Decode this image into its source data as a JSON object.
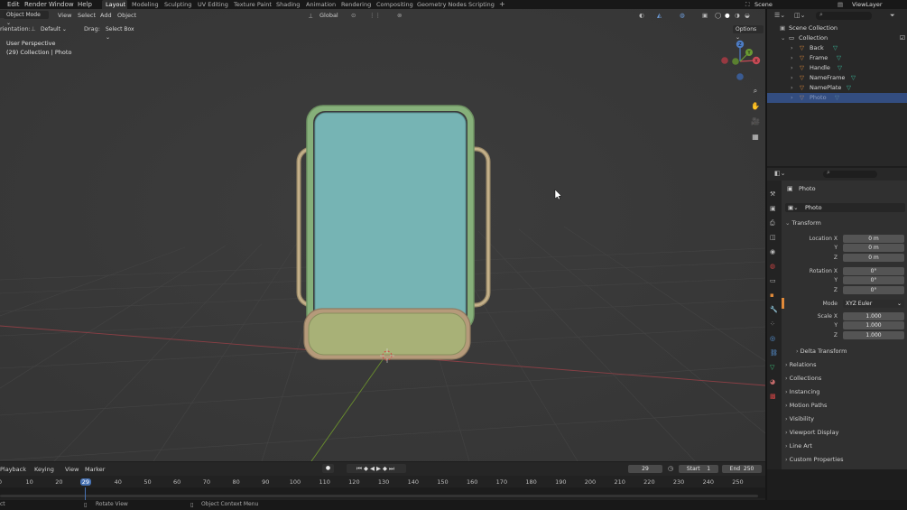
{
  "colors": {
    "accent": "#4772b3",
    "selection": "#334d80",
    "bg": "#393939"
  },
  "menu": [
    "Edit",
    "Render",
    "Window",
    "Help"
  ],
  "workspaces": [
    "Layout",
    "Modeling",
    "Sculpting",
    "UV Editing",
    "Texture Paint",
    "Shading",
    "Animation",
    "Rendering",
    "Compositing",
    "Geometry Nodes",
    "Scripting"
  ],
  "scene_name": "Scene",
  "view_layer": "ViewLayer",
  "viewport_header": {
    "mode": "Object Mode",
    "view": "View",
    "select": "Select",
    "add": "Add",
    "object": "Object",
    "orientation_label": "rientation:",
    "orientation_value": "Default",
    "drag_label": "Drag:",
    "drag_value": "Select Box",
    "transform_space": "Global",
    "options": "Options"
  },
  "viewport_overlay": {
    "perspective": "User Perspective",
    "collection": "(29) Collection | Photo"
  },
  "outliner": {
    "root": "Scene Collection",
    "collection": "Collection",
    "items": [
      "Back",
      "Frame",
      "Handle",
      "NameFrame",
      "NamePlate",
      "Photo"
    ]
  },
  "properties": {
    "object_name": "Photo",
    "data_name": "Photo",
    "transform_header": "Transform",
    "location_label": "Location X",
    "y_label": "Y",
    "z_label": "Z",
    "location": [
      "0 m",
      "0 m",
      "0 m"
    ],
    "rotation_label": "Rotation X",
    "rotation": [
      "0°",
      "0°",
      "0°"
    ],
    "mode_label": "Mode",
    "mode_value": "XYZ Euler",
    "scale_label": "Scale X",
    "scale": [
      "1.000",
      "1.000",
      "1.000"
    ],
    "delta": "Delta Transform",
    "panels": [
      "Relations",
      "Collections",
      "Instancing",
      "Motion Paths",
      "Visibility",
      "Viewport Display",
      "Line Art",
      "Custom Properties"
    ]
  },
  "timeline": {
    "menus": [
      "Playback",
      "Keying",
      "View",
      "Marker"
    ],
    "current_frame": "29",
    "start_label": "Start",
    "start": "1",
    "end_label": "End",
    "end": "250",
    "ticks": [
      "0",
      "10",
      "20",
      "29",
      "40",
      "50",
      "60",
      "70",
      "80",
      "90",
      "100",
      "110",
      "120",
      "130",
      "140",
      "150",
      "160",
      "170",
      "180",
      "190",
      "200",
      "210",
      "220",
      "230",
      "240",
      "250"
    ]
  },
  "status": {
    "left": "ct",
    "rotate": "Rotate View",
    "context": "Object Context Menu"
  }
}
